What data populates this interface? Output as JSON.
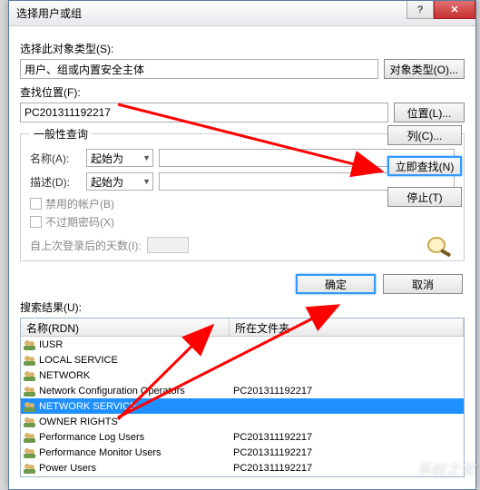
{
  "title": "选择用户或组",
  "labels": {
    "object_type": "选择此对象类型(S):",
    "location": "查找位置(F):",
    "groupbox": "一般性查询",
    "name": "名称(A):",
    "desc": "描述(D):",
    "disabled_acct": "禁用的帐户(B)",
    "no_expire": "不过期密码(X)",
    "days_since": "自上次登录后的天数(I):",
    "results": "搜索结果(U):",
    "col_name": "名称(RDN)",
    "col_folder": "所在文件夹"
  },
  "values": {
    "object_type": "用户、组或内置安全主体",
    "location": "PC201311192217",
    "combo": "起始为"
  },
  "buttons": {
    "object_types": "对象类型(O)...",
    "locations": "位置(L)...",
    "columns": "列(C)...",
    "find_now": "立即查找(N)",
    "stop": "停止(T)",
    "ok": "确定",
    "cancel": "取消",
    "help": "?",
    "close": "✕"
  },
  "results": [
    {
      "name": "IUSR",
      "loc": ""
    },
    {
      "name": "LOCAL SERVICE",
      "loc": ""
    },
    {
      "name": "NETWORK",
      "loc": ""
    },
    {
      "name": "Network Configuration Operators",
      "loc": "PC201311192217"
    },
    {
      "name": "NETWORK SERVICE",
      "loc": "",
      "selected": true
    },
    {
      "name": "OWNER RIGHTS",
      "loc": ""
    },
    {
      "name": "Performance Log Users",
      "loc": "PC201311192217"
    },
    {
      "name": "Performance Monitor Users",
      "loc": "PC201311192217"
    },
    {
      "name": "Power Users",
      "loc": "PC201311192217"
    }
  ],
  "watermark": "系统之家"
}
